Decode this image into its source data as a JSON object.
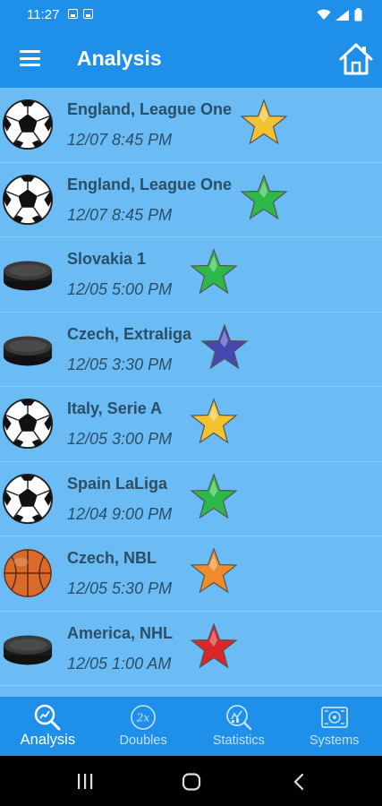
{
  "status": {
    "time": "11:27"
  },
  "app": {
    "title": "Analysis"
  },
  "items": [
    {
      "sport": "soccer",
      "league": "England, League One",
      "datetime": "12/07 8:45 PM",
      "star_color": "#f2c230"
    },
    {
      "sport": "soccer",
      "league": "England, League One",
      "datetime": "12/07 8:45 PM",
      "star_color": "#2fb84a"
    },
    {
      "sport": "hockey",
      "league": "Slovakia 1",
      "datetime": "12/05 5:00 PM",
      "star_color": "#2fb84a"
    },
    {
      "sport": "hockey",
      "league": "Czech, Extraliga",
      "datetime": "12/05 3:30 PM",
      "star_color": "#4548b0"
    },
    {
      "sport": "soccer",
      "league": "Italy, Serie A",
      "datetime": "12/05 3:00 PM",
      "star_color": "#f2c230"
    },
    {
      "sport": "soccer",
      "league": "Spain LaLiga",
      "datetime": "12/04 9:00 PM",
      "star_color": "#2fb84a"
    },
    {
      "sport": "basketball",
      "league": "Czech, NBL",
      "datetime": "12/05 5:30 PM",
      "star_color": "#f08a2a"
    },
    {
      "sport": "hockey",
      "league": "America, NHL",
      "datetime": "12/05 1:00 AM",
      "star_color": "#d8262b"
    }
  ],
  "nav": {
    "tabs": [
      {
        "label": "Analysis",
        "icon": "analysis-icon",
        "active": true
      },
      {
        "label": "Doubles",
        "icon": "doubles-icon",
        "active": false
      },
      {
        "label": "Statistics",
        "icon": "statistics-icon",
        "active": false
      },
      {
        "label": "Systems",
        "icon": "systems-icon",
        "active": false
      }
    ]
  },
  "colors": {
    "app_bar": "#1e90ea",
    "list_bg": "#6bbbf5",
    "text": "#2a4f66"
  }
}
